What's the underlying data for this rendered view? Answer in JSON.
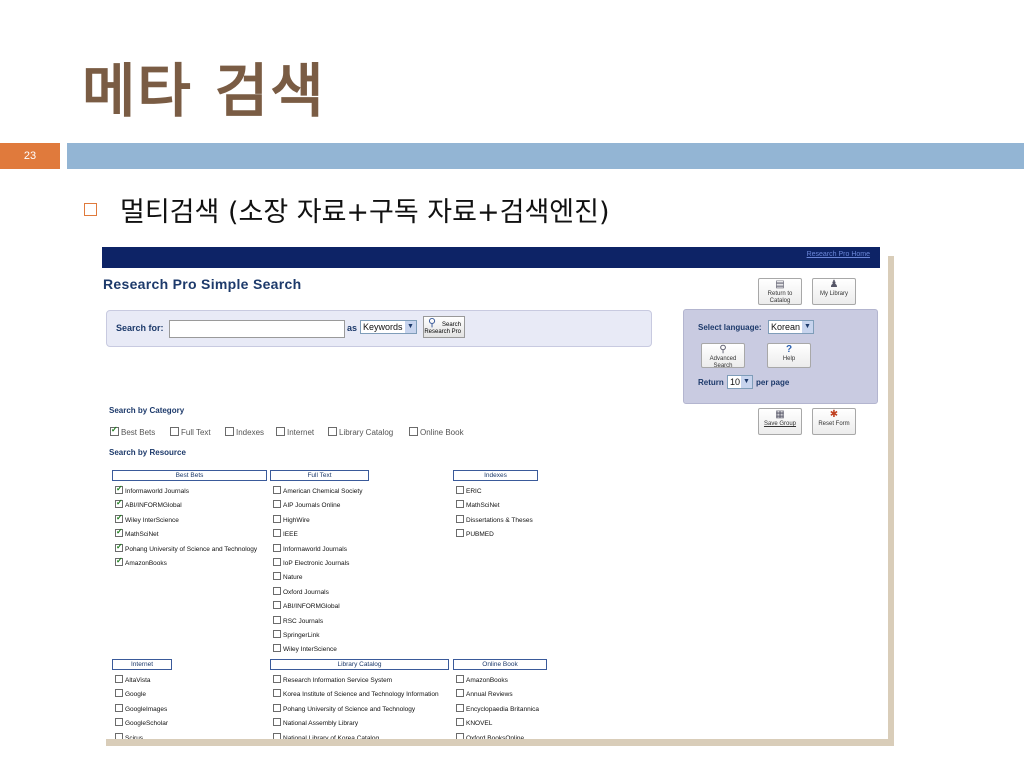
{
  "slide": {
    "title": "메타 검색",
    "page_number": "23",
    "bullet_text": "멀티검색 (소장 자료+구독 자료+검색엔진)"
  },
  "app": {
    "top_link": "Research Pro Home",
    "title": "Research Pro Simple Search",
    "return_catalog": "Return to Catalog",
    "my_library": "My Library",
    "search_for_label": "Search for:",
    "search_value": "",
    "as_label": "as",
    "search_type": "Keywords",
    "search_button": "Search Research Pro",
    "select_language_label": "Select language:",
    "language": "Korean",
    "advanced_search": "Advanced Search",
    "help": "Help",
    "return_label": "Return",
    "per_page_value": "10",
    "per_page_label": "per page",
    "save_group": "Save Group",
    "reset_form": "Reset Form",
    "search_by_category": "Search by Category",
    "search_by_resource": "Search by Resource",
    "categories": [
      {
        "label": "Best Bets",
        "checked": true
      },
      {
        "label": "Full Text",
        "checked": false
      },
      {
        "label": "Indexes",
        "checked": false
      },
      {
        "label": "Internet",
        "checked": false
      },
      {
        "label": "Library Catalog",
        "checked": false
      },
      {
        "label": "Online Book",
        "checked": false
      }
    ],
    "groups": [
      {
        "name": "Best Bets",
        "items": [
          {
            "label": "Informaworld Journals",
            "checked": true
          },
          {
            "label": "ABI/INFORMGlobal",
            "checked": true
          },
          {
            "label": "Wiley InterScience",
            "checked": true
          },
          {
            "label": "MathSciNet",
            "checked": true
          },
          {
            "label": "Pohang University of Science and Technology",
            "checked": true
          },
          {
            "label": "AmazonBooks",
            "checked": true
          }
        ]
      },
      {
        "name": "Full Text",
        "items": [
          {
            "label": "American Chemical Society",
            "checked": false
          },
          {
            "label": "AIP Journals Online",
            "checked": false
          },
          {
            "label": "HighWire",
            "checked": false
          },
          {
            "label": "IEEE",
            "checked": false
          },
          {
            "label": "Informaworld Journals",
            "checked": false
          },
          {
            "label": "IoP Electronic Journals",
            "checked": false
          },
          {
            "label": "Nature",
            "checked": false
          },
          {
            "label": "Oxford Journals",
            "checked": false
          },
          {
            "label": "ABI/INFORMGlobal",
            "checked": false
          },
          {
            "label": "RSC Journals",
            "checked": false
          },
          {
            "label": "SpringerLink",
            "checked": false
          },
          {
            "label": "Wiley InterScience",
            "checked": false
          }
        ]
      },
      {
        "name": "Indexes",
        "items": [
          {
            "label": "ERIC",
            "checked": false
          },
          {
            "label": "MathSciNet",
            "checked": false
          },
          {
            "label": "Dissertations & Theses",
            "checked": false
          },
          {
            "label": "PUBMED",
            "checked": false
          }
        ]
      },
      {
        "name": "Internet",
        "items": [
          {
            "label": "AltaVista",
            "checked": false
          },
          {
            "label": "Google",
            "checked": false
          },
          {
            "label": "GoogleImages",
            "checked": false
          },
          {
            "label": "GoogleScholar",
            "checked": false
          },
          {
            "label": "Scirus",
            "checked": false
          }
        ]
      },
      {
        "name": "Library Catalog",
        "items": [
          {
            "label": "Research Information Service System",
            "checked": false
          },
          {
            "label": "Korea Institute of Science and Technology Information",
            "checked": false
          },
          {
            "label": "Pohang University of Science and Technology",
            "checked": false
          },
          {
            "label": "National Assembly Library",
            "checked": false
          },
          {
            "label": "National Library of Korea Catalog",
            "checked": false
          }
        ]
      },
      {
        "name": "Online Book",
        "items": [
          {
            "label": "AmazonBooks",
            "checked": false
          },
          {
            "label": "Annual Reviews",
            "checked": false
          },
          {
            "label": "Encyclopaedia Britannica",
            "checked": false
          },
          {
            "label": "KNOVEL",
            "checked": false
          },
          {
            "label": "Oxford BooksOnline",
            "checked": false
          }
        ]
      }
    ]
  }
}
